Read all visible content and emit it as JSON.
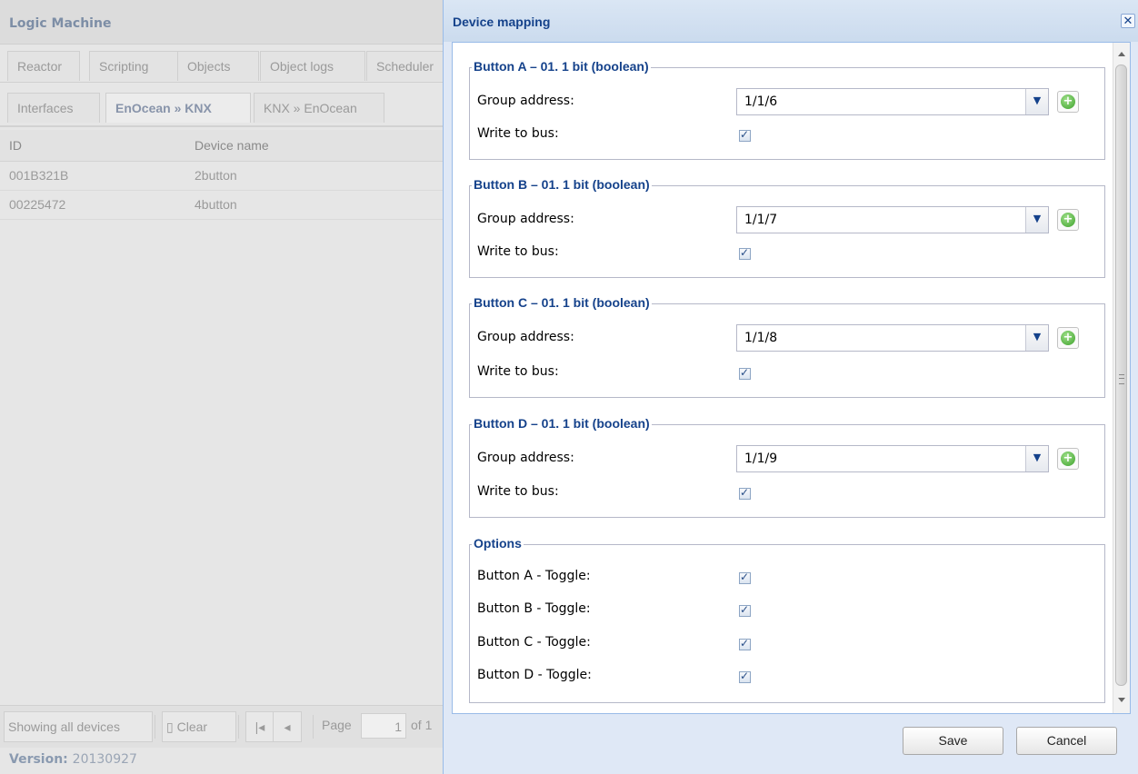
{
  "app": {
    "title": "Logic Machine",
    "tabs": [
      "Reactor",
      "Scripting",
      "Objects",
      "Object logs",
      "Scheduler"
    ],
    "subtabs": [
      "Interfaces",
      "EnOcean » KNX",
      "KNX » EnOcean"
    ],
    "grid": {
      "columns": [
        "ID",
        "Device name"
      ],
      "rows": [
        {
          "id": "001B321B",
          "name": "2button"
        },
        {
          "id": "00225472",
          "name": "4button"
        }
      ]
    },
    "toolbar": {
      "showing": "Showing all devices",
      "clear": "Clear",
      "first_icon": "first-page-icon",
      "prev_icon": "prev-page-icon",
      "page_label": "Page",
      "page_value": "1",
      "of_label": "of 1"
    },
    "version_label": "Version:",
    "version_value": "20130927"
  },
  "dialog": {
    "title": "Device mapping",
    "close_icon": "close-icon",
    "sections": [
      {
        "legend": "Button A – 01. 1 bit (boolean)",
        "group_label": "Group address:",
        "group_value": "1/1/6",
        "write_label": "Write to bus:",
        "write_checked": true
      },
      {
        "legend": "Button B – 01. 1 bit (boolean)",
        "group_label": "Group address:",
        "group_value": "1/1/7",
        "write_label": "Write to bus:",
        "write_checked": true
      },
      {
        "legend": "Button C – 01. 1 bit (boolean)",
        "group_label": "Group address:",
        "group_value": "1/1/8",
        "write_label": "Write to bus:",
        "write_checked": true
      },
      {
        "legend": "Button D – 01. 1 bit (boolean)",
        "group_label": "Group address:",
        "group_value": "1/1/9",
        "write_label": "Write to bus:",
        "write_checked": true
      }
    ],
    "options": {
      "legend": "Options",
      "items": [
        {
          "label": "Button A - Toggle:",
          "checked": true
        },
        {
          "label": "Button B - Toggle:",
          "checked": true
        },
        {
          "label": "Button C - Toggle:",
          "checked": true
        },
        {
          "label": "Button D - Toggle:",
          "checked": true
        }
      ]
    },
    "save_label": "Save",
    "cancel_label": "Cancel",
    "check_glyph": "✓",
    "plus_glyph": "+",
    "dropdown_glyph": "▼"
  }
}
